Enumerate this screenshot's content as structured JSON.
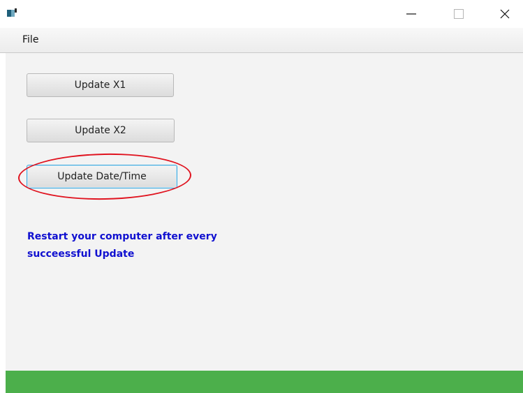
{
  "window": {
    "controls": {
      "minimize_icon": "minimize-icon",
      "maximize_icon": "maximize-icon",
      "close_icon": "close-icon"
    }
  },
  "menubar": {
    "items": [
      {
        "label": "File"
      }
    ]
  },
  "main": {
    "buttons": [
      {
        "label": "Update X1"
      },
      {
        "label": "Update X2"
      },
      {
        "label": "Update Date/Time"
      }
    ],
    "notice": {
      "line1": "Restart your computer after every",
      "line2": "succeessful Update",
      "color": "#1010d0"
    }
  },
  "colors": {
    "statusbar": "#4caf4b",
    "highlight": "#e0131f",
    "focus_border": "#39a7dc"
  }
}
